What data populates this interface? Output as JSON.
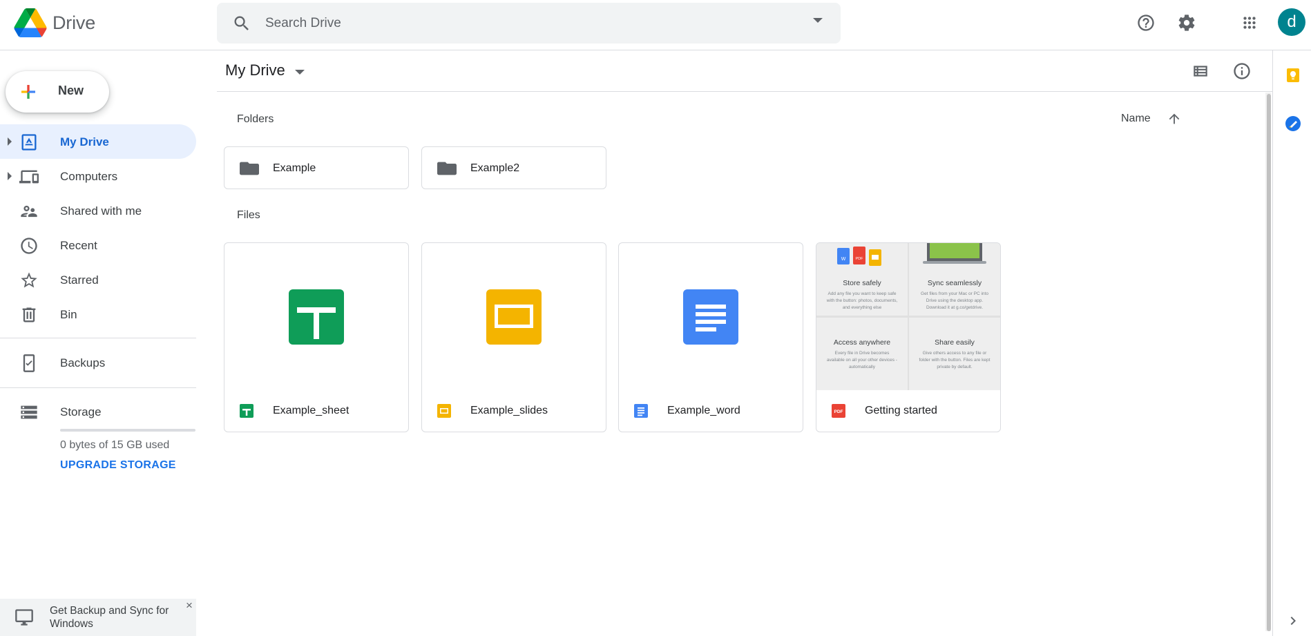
{
  "app": {
    "name": "Drive"
  },
  "search": {
    "placeholder": "Search Drive"
  },
  "user": {
    "avatar_initial": "d"
  },
  "sidebar": {
    "new_label": "New",
    "items": [
      {
        "label": "My Drive"
      },
      {
        "label": "Computers"
      },
      {
        "label": "Shared with me"
      },
      {
        "label": "Recent"
      },
      {
        "label": "Starred"
      },
      {
        "label": "Bin"
      },
      {
        "label": "Backups"
      },
      {
        "label": "Storage"
      }
    ],
    "storage_used": "0 bytes of 15 GB used",
    "upgrade_label": "UPGRADE STORAGE",
    "backup_banner": "Get Backup and Sync for Windows"
  },
  "main": {
    "breadcrumb": "My Drive",
    "folders_label": "Folders",
    "files_label": "Files",
    "sort_label": "Name",
    "folders": [
      {
        "name": "Example"
      },
      {
        "name": "Example2"
      }
    ],
    "files": [
      {
        "name": "Example_sheet",
        "type": "sheet"
      },
      {
        "name": "Example_slides",
        "type": "slides"
      },
      {
        "name": "Example_word",
        "type": "doc"
      },
      {
        "name": "Getting started",
        "type": "pdf"
      }
    ],
    "getting_started_preview": {
      "cells": [
        {
          "title": "Store safely",
          "desc": "Add any file you want to keep safe with the button: photos, documents, and everything else"
        },
        {
          "title": "Sync seamlessly",
          "desc": "Get files from your Mac or PC into Drive using the desktop app. Download it at g.co/getdrive."
        },
        {
          "title": "Access anywhere",
          "desc": "Every file in Drive becomes available on all your other devices - automatically"
        },
        {
          "title": "Share easily",
          "desc": "Give others access to any file or folder with the button. Files are kept private by default."
        }
      ]
    }
  },
  "colors": {
    "accent": "#1a73e8",
    "active_bg": "#e8f0fe",
    "sheets_green": "#0f9d58",
    "slides_yellow": "#f4b400",
    "docs_blue": "#4285f4",
    "pdf_red": "#ea4335",
    "avatar_teal": "#00838f"
  }
}
